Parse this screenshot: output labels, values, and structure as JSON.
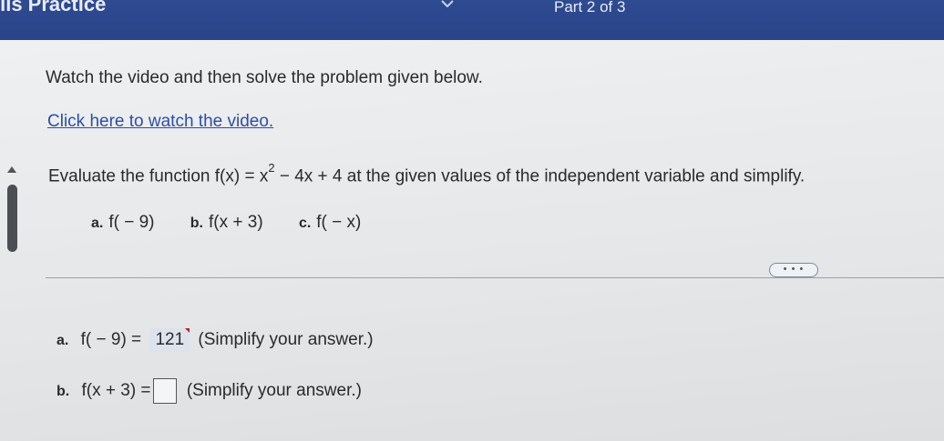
{
  "header": {
    "title": "ills Practice",
    "part": "Part 2 of 3"
  },
  "instructions": "Watch the video and then solve the problem given below.",
  "video_link": "Click here to watch the video.",
  "problem": {
    "lead": "Evaluate the function f(x) = x",
    "exponent": "2",
    "tail": " − 4x + 4 at the given values of the independent variable and simplify."
  },
  "parts": [
    {
      "label": "a.",
      "expr": "f( − 9)"
    },
    {
      "label": "b.",
      "expr": "f(x + 3)"
    },
    {
      "label": "c.",
      "expr": "f( − x)"
    }
  ],
  "more_button": "• • •",
  "answer_a": {
    "label": "a.",
    "expr": "f( − 9) =",
    "value": "121",
    "hint": "(Simplify your answer.)"
  },
  "answer_b": {
    "label": "b.",
    "expr": "f(x + 3) =",
    "value": "",
    "hint": "(Simplify your answer.)"
  }
}
